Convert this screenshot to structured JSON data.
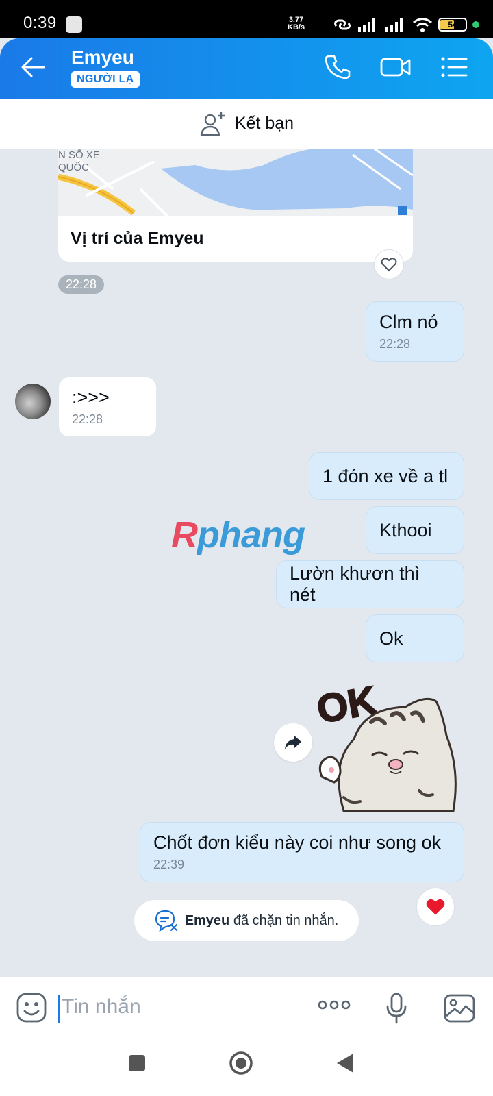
{
  "status_bar": {
    "time": "0:39",
    "speed_value": "3.77",
    "speed_unit": "KB/s",
    "battery": "54"
  },
  "header": {
    "title": "Emyeu",
    "tag": "NGƯỜI LẠ"
  },
  "friend_bar": {
    "label": "Kết bạn"
  },
  "location_card": {
    "map_text_1": "N SỐ XE",
    "map_text_2": "QUỐC",
    "label": "Vị trí của Emyeu"
  },
  "time_pill": "22:28",
  "messages": [
    {
      "dir": "out",
      "text": "Clm nó",
      "time": "22:28"
    },
    {
      "dir": "in",
      "text": ":>>>",
      "time": "22:28"
    },
    {
      "dir": "out",
      "text": "1 đón xe về a tl"
    },
    {
      "dir": "out",
      "text": "Kthooi"
    },
    {
      "dir": "out",
      "text": "Lườn khươn thì nét"
    },
    {
      "dir": "out",
      "text": "Ok"
    },
    {
      "dir": "out",
      "text": "Chốt đơn kiểu này coi như song ok",
      "time": "22:39"
    }
  ],
  "watermark": {
    "first": "R",
    "rest": "phang"
  },
  "sticker": {
    "text": "OK"
  },
  "blocked_notice": {
    "name": "Emyeu",
    "text": "đã chặn tin nhắn."
  },
  "input": {
    "placeholder": "Tin nhắn"
  },
  "colors": {
    "header_start": "#1a7ae8",
    "header_end": "#0ea5f0",
    "outgoing_bubble": "#d8ecfb",
    "chat_background": "#e2e8ee",
    "heart": "#e8192c"
  },
  "icons": {
    "header": [
      "back-arrow-icon",
      "phone-icon",
      "video-call-icon",
      "menu-list-icon"
    ],
    "input": [
      "emoji-icon",
      "more-dots-icon",
      "microphone-icon",
      "gallery-icon"
    ],
    "nav": [
      "recent-apps-icon",
      "home-icon",
      "back-icon"
    ]
  }
}
